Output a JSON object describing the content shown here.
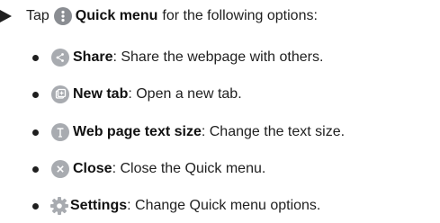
{
  "intro": {
    "prefix": "Tap",
    "bold": "Quick menu",
    "suffix": "for the following options:",
    "icon": "more-vertical-icon"
  },
  "options": [
    {
      "icon": "share-icon",
      "title": "Share",
      "desc": ": Share the webpage with others."
    },
    {
      "icon": "new-tab-icon",
      "title": "New tab",
      "desc": ": Open a new tab."
    },
    {
      "icon": "text-size-icon",
      "title": "Web page text size",
      "desc": ": Change the text size."
    },
    {
      "icon": "close-icon",
      "title": "Close",
      "desc": ": Close the Quick menu."
    },
    {
      "icon": "gear-icon",
      "title": "Settings",
      "desc": ": Change Quick menu options."
    }
  ]
}
